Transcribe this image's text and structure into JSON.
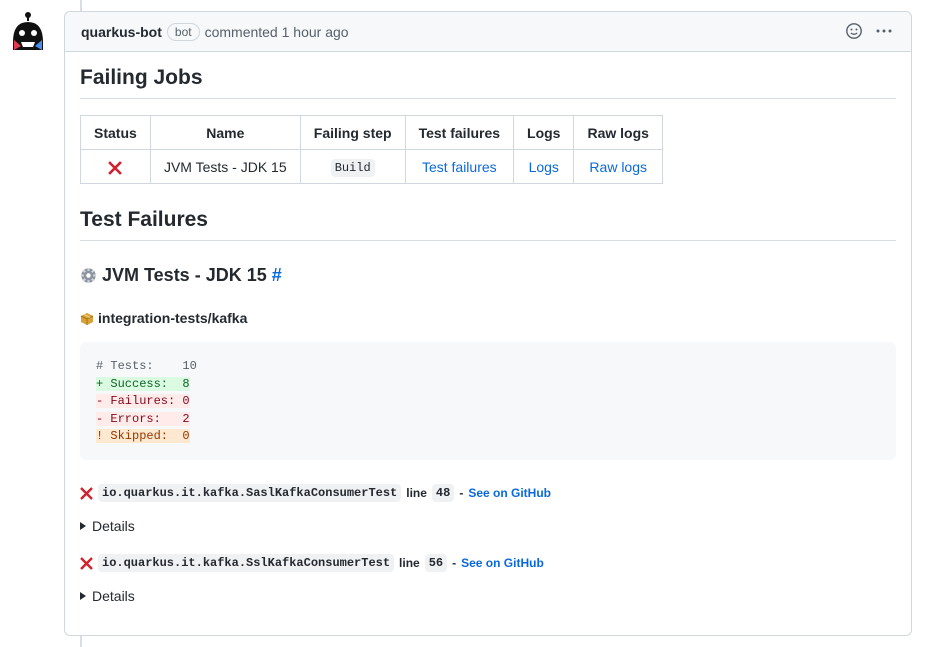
{
  "comment": {
    "author": "quarkus-bot",
    "badge": "bot",
    "action_time": "commented 1 hour ago"
  },
  "failing_jobs": {
    "title": "Failing Jobs",
    "headers": [
      "Status",
      "Name",
      "Failing step",
      "Test failures",
      "Logs",
      "Raw logs"
    ],
    "row": {
      "status_icon": "red-x-icon",
      "name": "JVM Tests - JDK 15",
      "failing_step": "Build",
      "test_failures": "Test failures",
      "logs": "Logs",
      "raw_logs": "Raw logs"
    }
  },
  "test_failures": {
    "title": "Test Failures",
    "job_title": "JVM Tests - JDK 15",
    "job_anchor": "#",
    "module": "integration-tests/kafka",
    "summary": {
      "tests": "# Tests:    10",
      "success": "+ Success:  8",
      "failures": "- Failures: 0",
      "errors": "- Errors:   2",
      "skipped": "! Skipped:  0"
    },
    "failures": [
      {
        "class_name": "io.quarkus.it.kafka.SaslKafkaConsumerTest",
        "line_label": "line",
        "line_number": "48",
        "separator": "-",
        "link": "See on GitHub",
        "details": "Details"
      },
      {
        "class_name": "io.quarkus.it.kafka.SslKafkaConsumerTest",
        "line_label": "line",
        "line_number": "56",
        "separator": "-",
        "link": "See on GitHub",
        "details": "Details"
      }
    ]
  },
  "colors": {
    "link": "#0969da",
    "error_red": "#cf222e",
    "border": "#d0d7de"
  }
}
